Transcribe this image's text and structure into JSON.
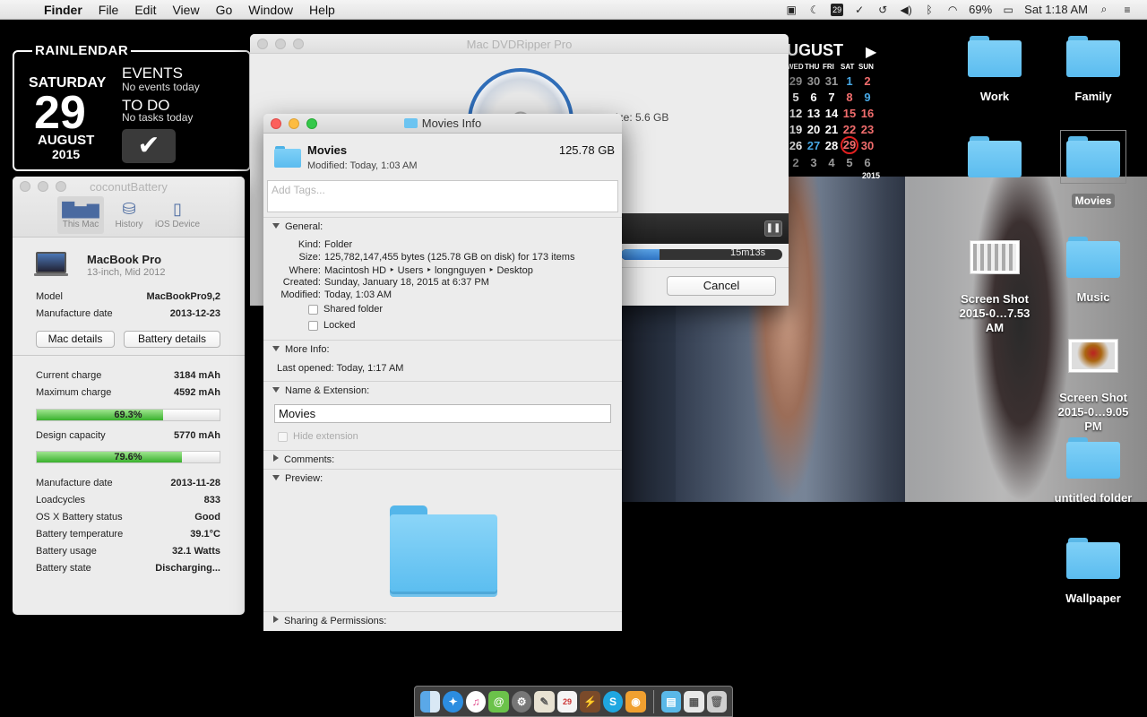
{
  "menubar": {
    "app": "Finder",
    "items": [
      "File",
      "Edit",
      "View",
      "Go",
      "Window",
      "Help"
    ],
    "date_icon": "29",
    "battery": "69%",
    "clock": "Sat 1:18 AM"
  },
  "rainlendar": {
    "brand": "RAINLENDAR",
    "day_name": "SATURDAY",
    "day_number": "29",
    "month": "AUGUST",
    "year": "2015",
    "events_heading": "EVENTS",
    "events_sub": "No events today",
    "todo_heading": "TO DO",
    "todo_sub": "No tasks today"
  },
  "month_calendar": {
    "title": "UGUST",
    "weekdays": [
      "WED",
      "THU",
      "FRI",
      "SAT",
      "SUN"
    ],
    "rows": [
      [
        "29",
        "30",
        "31",
        "1",
        "2"
      ],
      [
        "5",
        "6",
        "7",
        "8",
        "9"
      ],
      [
        "12",
        "13",
        "14",
        "15",
        "16"
      ],
      [
        "19",
        "20",
        "21",
        "22",
        "23"
      ],
      [
        "26",
        "27",
        "28",
        "29",
        "30"
      ],
      [
        "2",
        "3",
        "4",
        "5",
        "6"
      ]
    ],
    "year": "2015"
  },
  "dvdripper": {
    "title": "Mac DVDRipper Pro",
    "size_text": "ize: 5.6 GB",
    "time": "15m13s",
    "cancel": "Cancel"
  },
  "coconut": {
    "title": "coconutBattery",
    "tabs": [
      "This Mac",
      "History",
      "iOS Device"
    ],
    "device_name": "MacBook Pro",
    "device_sub": "13-inch, Mid 2012",
    "model_label": "Model",
    "model_value": "MacBookPro9,2",
    "mfg_label": "Manufacture date",
    "mfg_value": "2013-12-23",
    "mac_details": "Mac details",
    "battery_details": "Battery details",
    "current_charge_label": "Current charge",
    "current_charge_value": "3184 mAh",
    "max_charge_label": "Maximum charge",
    "max_charge_value": "4592 mAh",
    "charge_percent": "69.3%",
    "charge_fraction": 0.693,
    "design_label": "Design capacity",
    "design_value": "5770 mAh",
    "design_percent": "79.6%",
    "design_fraction": 0.796,
    "bat_mfg_label": "Manufacture date",
    "bat_mfg_value": "2013-11-28",
    "loadcycles_label": "Loadcycles",
    "loadcycles_value": "833",
    "status_label": "OS X Battery status",
    "status_value": "Good",
    "temp_label": "Battery temperature",
    "temp_value": "39.1°C",
    "usage_label": "Battery usage",
    "usage_value": "32.1 Watts",
    "state_label": "Battery state",
    "state_value": "Discharging..."
  },
  "info": {
    "title": "Movies Info",
    "name": "Movies",
    "size": "125.78 GB",
    "modified": "Modified: Today, 1:03 AM",
    "tags_placeholder": "Add Tags...",
    "general": "General:",
    "kind_k": "Kind:",
    "kind_v": "Folder",
    "size_k": "Size:",
    "size_v": "125,782,147,455 bytes (125.78 GB on disk) for 173 items",
    "where_k": "Where:",
    "where_v": "Macintosh HD ‣ Users ‣ longnguyen ‣ Desktop",
    "created_k": "Created:",
    "created_v": "Sunday, January 18, 2015 at 6:37 PM",
    "modified_k": "Modified:",
    "modified_v": "Today, 1:03 AM",
    "shared": "Shared folder",
    "locked": "Locked",
    "more_info": "More Info:",
    "last_opened": "Last opened: Today, 1:17 AM",
    "name_ext": "Name & Extension:",
    "name_field": "Movies",
    "hide_ext": "Hide extension",
    "comments": "Comments:",
    "preview": "Preview:",
    "sharing": "Sharing & Permissions:"
  },
  "desktop": {
    "work": "Work",
    "family": "Family",
    "movies": "Movies",
    "screenshot1_l1": "Screen Shot",
    "screenshot1_l2": "2015-0…7.53 AM",
    "music": "Music",
    "screenshot2_l1": "Screen Shot",
    "screenshot2_l2": "2015-0…9.05 PM",
    "untitled": "untitled folder",
    "wallpaper": "Wallpaper"
  }
}
